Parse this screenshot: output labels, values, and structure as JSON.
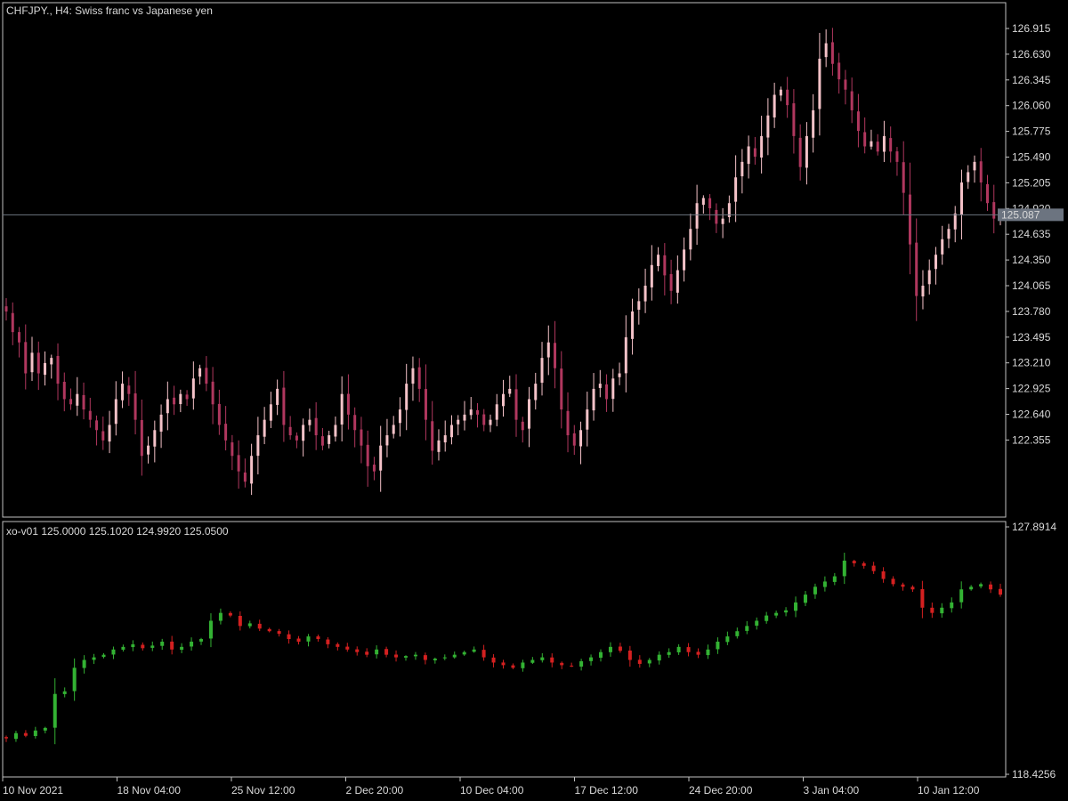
{
  "header": {
    "symbol_line": "CHFJPY., H4:  Swiss franc vs Japanese yen",
    "indicator_line": "xo-v01 125.0000 125.1020 124.9920 125.0500"
  },
  "colors": {
    "background": "#000000",
    "frame": "#c0c0c0",
    "price_bull": "#f4c2c8",
    "price_bear": "#b0375e",
    "ind_bull": "#33b233",
    "ind_bear": "#d42020",
    "current_line": "#6c7480",
    "price_tag_bg": "#6c7480"
  },
  "main_axis": {
    "ticks": [
      "126.915",
      "126.630",
      "126.345",
      "126.060",
      "125.775",
      "125.490",
      "125.205",
      "124.920",
      "124.635",
      "124.350",
      "124.065",
      "123.780",
      "123.495",
      "123.210",
      "122.925",
      "122.640",
      "122.355"
    ],
    "current_price": "125.087"
  },
  "ind_axis": {
    "max_label": "127.8914",
    "min_label": "118.4256"
  },
  "time_axis": {
    "labels": [
      "10 Nov 2021",
      "18 Nov 04:00",
      "25 Nov 12:00",
      "2 Dec 20:00",
      "10 Dec 04:00",
      "17 Dec 12:00",
      "24 Dec 20:00",
      "3 Jan 04:00",
      "10 Jan 12:00"
    ]
  },
  "chart_data": [
    {
      "type": "candlestick",
      "title": "CHFJPY., H4:  Swiss franc vs Japanese yen",
      "ylim": [
        122.2,
        127.1
      ],
      "closes": [
        124.15,
        123.95,
        123.85,
        123.55,
        123.75,
        123.55,
        123.65,
        123.7,
        123.45,
        123.3,
        123.25,
        123.35,
        123.2,
        123.1,
        123.0,
        122.9,
        123.05,
        123.3,
        123.45,
        123.35,
        123.1,
        122.75,
        122.85,
        123.0,
        123.15,
        123.3,
        123.25,
        123.35,
        123.3,
        123.5,
        123.6,
        123.45,
        123.25,
        123.05,
        122.9,
        122.75,
        122.6,
        122.5,
        122.75,
        122.95,
        123.1,
        123.25,
        123.4,
        123.05,
        122.95,
        122.9,
        123.05,
        123.1,
        122.95,
        122.85,
        122.95,
        123.05,
        123.35,
        123.15,
        123.0,
        122.85,
        122.65,
        122.6,
        122.85,
        122.95,
        123.05,
        123.2,
        123.45,
        123.6,
        123.4,
        123.1,
        122.8,
        122.9,
        122.95,
        123.05,
        123.1,
        123.15,
        123.2,
        123.15,
        123.05,
        123.1,
        123.25,
        123.35,
        123.4,
        123.1,
        123.0,
        123.3,
        123.45,
        123.7,
        123.85,
        123.6,
        123.2,
        122.95,
        122.85,
        123.0,
        123.2,
        123.4,
        123.45,
        123.3,
        123.5,
        123.55,
        123.9,
        124.15,
        124.25,
        124.4,
        124.6,
        124.7,
        124.5,
        124.35,
        124.55,
        124.75,
        124.95,
        125.2,
        125.25,
        125.15,
        125.0,
        125.05,
        125.2,
        125.45,
        125.6,
        125.75,
        125.65,
        125.85,
        126.05,
        126.25,
        126.3,
        126.15,
        125.85,
        125.55,
        125.85,
        126.1,
        126.6,
        126.75,
        126.55,
        126.4,
        126.3,
        126.1,
        125.9,
        125.75,
        125.8,
        125.7,
        125.85,
        125.7,
        125.6,
        125.3,
        124.8,
        124.3,
        124.4,
        124.55,
        124.7,
        124.85,
        124.95,
        125.1,
        125.4,
        125.5,
        125.6,
        125.4,
        125.2,
        125.05,
        125.087
      ],
      "current_price": 125.087
    },
    {
      "type": "candlestick",
      "title": "xo-v01",
      "ylim": [
        118.4256,
        127.8914
      ],
      "closes": [
        119.8,
        120.0,
        119.9,
        120.1,
        120.2,
        121.5,
        121.6,
        122.5,
        122.8,
        122.9,
        123.0,
        123.2,
        123.3,
        123.4,
        123.25,
        123.35,
        123.5,
        123.2,
        123.3,
        123.5,
        123.6,
        124.3,
        124.6,
        124.5,
        124.1,
        124.2,
        124.0,
        123.9,
        123.8,
        123.6,
        123.5,
        123.7,
        123.6,
        123.4,
        123.3,
        123.2,
        123.1,
        123.0,
        123.2,
        123.0,
        122.9,
        122.95,
        123.0,
        122.8,
        122.85,
        122.9,
        123.0,
        123.1,
        123.2,
        122.9,
        122.7,
        122.6,
        122.5,
        122.7,
        122.8,
        122.9,
        122.7,
        122.6,
        122.55,
        122.75,
        122.9,
        123.1,
        123.3,
        123.15,
        122.8,
        122.65,
        122.8,
        123.0,
        123.1,
        123.3,
        123.1,
        123.0,
        123.2,
        123.5,
        123.7,
        123.9,
        124.1,
        124.3,
        124.5,
        124.6,
        124.7,
        125.0,
        125.3,
        125.6,
        125.8,
        126.0,
        126.6,
        126.5,
        126.4,
        126.2,
        125.9,
        125.7,
        125.6,
        125.5,
        124.8,
        124.6,
        124.8,
        125.0,
        125.5,
        125.6,
        125.7,
        125.5,
        125.3
      ]
    }
  ]
}
